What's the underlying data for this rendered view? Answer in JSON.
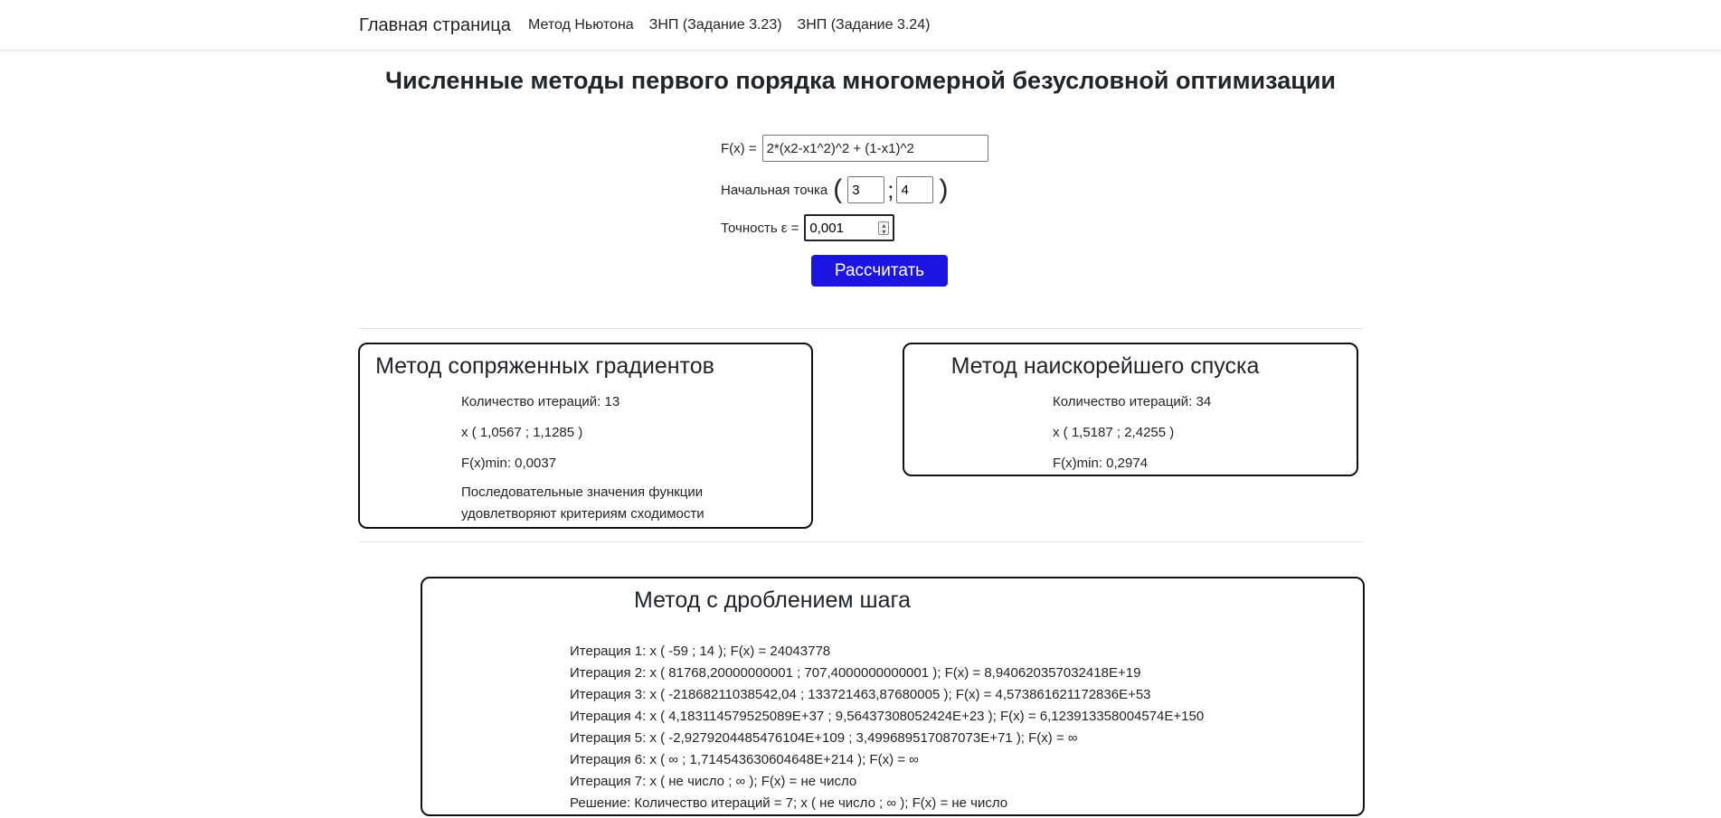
{
  "navbar": {
    "brand": "Главная страница",
    "links": [
      "Метод Ньютона",
      "ЗНП (Задание 3.23)",
      "ЗНП (Задание 3.24)"
    ]
  },
  "page_title": "Численные методы первого порядка многомерной безусловной оптимизации",
  "form": {
    "fx_label": "F(x) =",
    "fx_value": "2*(x2-x1^2)^2 + (1-x1)^2",
    "start_label": "Начальная точка",
    "open_paren": "(",
    "x1_value": "3",
    "separator": ";",
    "x2_value": "4",
    "close_paren": ")",
    "eps_label": "Точность ε =",
    "eps_value": "0,001",
    "submit_label": "Рассчитать"
  },
  "conjugate_gradients": {
    "title": "Метод сопряженных градиентов",
    "iterations": "Количество итераций: 13",
    "point": "x ( 1,0567 ; 1,1285 )",
    "fmin": "F(x)min: 0,0037",
    "convergence": "Последовательные значения функции удовлетворяют критериям сходимости"
  },
  "steepest_descent": {
    "title": "Метод наискорейшего спуска",
    "iterations": "Количество итераций: 34",
    "point": "x ( 1,5187 ; 2,4255 )",
    "fmin": "F(x)min: 0,2974"
  },
  "step_splitting": {
    "title": "Метод с дроблением шага",
    "lines": [
      "Итерация 1: x ( -59 ; 14 ); F(x) = 24043778",
      "Итерация 2: x ( 81768,20000000001 ; 707,4000000000001 ); F(x) = 8,940620357032418E+19",
      "Итерация 3: x ( -21868211038542,04 ; 133721463,87680005 ); F(x) = 4,573861621172836E+53",
      "Итерация 4: x ( 4,183114579525089E+37 ; 9,56437308052424E+23 ); F(x) = 6,123913358004574E+150",
      "Итерация 5: x ( -2,9279204485476104E+109 ; 3,499689517087073E+71 ); F(x) = ∞",
      "Итерация 6: x ( ∞ ; 1,714543630604648E+214 ); F(x) = ∞",
      "Итерация 7: x ( не число ; ∞ ); F(x) = не число",
      "Решение: Количество итераций = 7; x ( не число ; ∞ ); F(x) = не число"
    ]
  },
  "colors": {
    "button": "#1c14e0",
    "card_border": "#111111"
  }
}
